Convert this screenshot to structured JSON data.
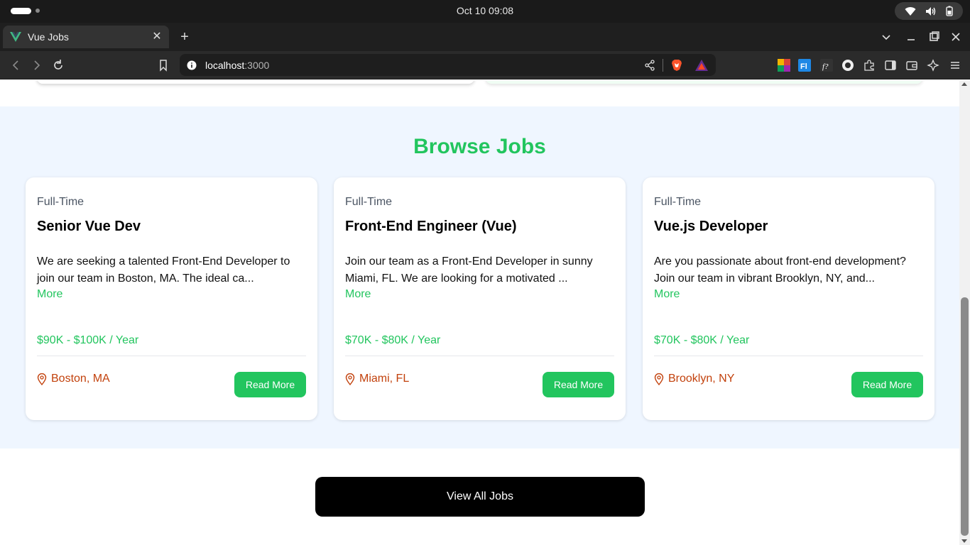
{
  "os": {
    "clock": "Oct 10  09:08"
  },
  "browser": {
    "tab_title": "Vue Jobs",
    "url_host": "localhost",
    "url_port": ":3000",
    "brand_color": "#41b883"
  },
  "section": {
    "title": "Browse Jobs"
  },
  "jobs": [
    {
      "type": "Full-Time",
      "title": "Senior Vue Dev",
      "description": "We are seeking a talented Front-End Developer to join our team in Boston, MA. The ideal ca...",
      "more": "More",
      "salary": "$90K - $100K / Year",
      "location": "Boston, MA",
      "button": "Read More"
    },
    {
      "type": "Full-Time",
      "title": "Front-End Engineer (Vue)",
      "description": "Join our team as a Front-End Developer in sunny Miami, FL. We are looking for a motivated ...",
      "more": "More",
      "salary": "$70K - $80K / Year",
      "location": "Miami, FL",
      "button": "Read More"
    },
    {
      "type": "Full-Time",
      "title": "Vue.js Developer",
      "description": "Are you passionate about front-end development? Join our team in vibrant Brooklyn, NY, and...",
      "more": "More",
      "salary": "$70K - $80K / Year",
      "location": "Brooklyn, NY",
      "button": "Read More"
    }
  ],
  "view_all": {
    "label": "View All Jobs"
  },
  "colors": {
    "accent": "#22c55e",
    "location": "#c2410c",
    "section_bg": "#eff6ff",
    "button_dark": "#000000"
  },
  "scroll": {
    "position_fraction": 0.95
  }
}
